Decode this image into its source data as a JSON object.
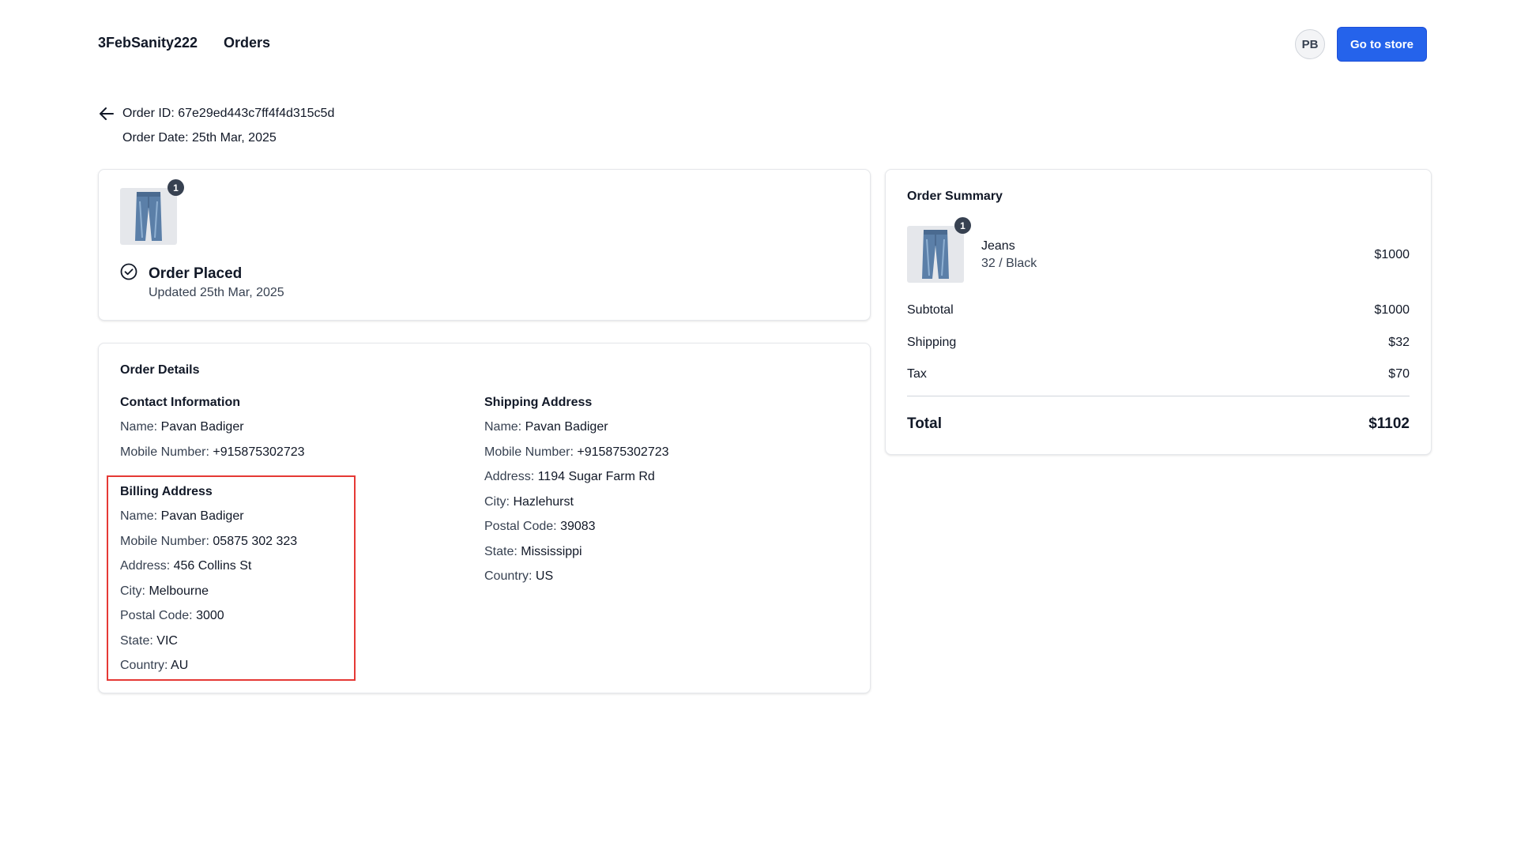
{
  "header": {
    "brand": "3FebSanity222",
    "nav_orders": "Orders",
    "avatar_initials": "PB",
    "store_button": "Go to store",
    "accent_color": "#2563eb"
  },
  "order": {
    "id_line": "Order ID: 67e29ed443c7ff4f4d315c5d",
    "date_line": "Order Date: 25th Mar, 2025"
  },
  "status": {
    "item_quantity": "1",
    "title": "Order Placed",
    "updated": "Updated 25th Mar, 2025"
  },
  "details": {
    "title": "Order Details",
    "contact": {
      "title": "Contact Information",
      "name_label": "Name:",
      "name": "Pavan Badiger",
      "mobile_label": "Mobile Number:",
      "mobile": "+915875302723"
    },
    "billing": {
      "title": "Billing Address",
      "name_label": "Name:",
      "name": "Pavan Badiger",
      "mobile_label": "Mobile Number:",
      "mobile": "05875 302 323",
      "address_label": "Address:",
      "address": "456 Collins St",
      "city_label": "City:",
      "city": "Melbourne",
      "postal_label": "Postal Code:",
      "postal": "3000",
      "state_label": "State:",
      "state": "VIC",
      "country_label": "Country:",
      "country": "AU"
    },
    "shipping": {
      "title": "Shipping Address",
      "name_label": "Name:",
      "name": "Pavan Badiger",
      "mobile_label": "Mobile Number:",
      "mobile": "+915875302723",
      "address_label": "Address:",
      "address": "1194 Sugar Farm Rd",
      "city_label": "City:",
      "city": "Hazlehurst",
      "postal_label": "Postal Code:",
      "postal": "39083",
      "state_label": "State:",
      "state": "Mississippi",
      "country_label": "Country:",
      "country": "US"
    }
  },
  "summary": {
    "title": "Order Summary",
    "item": {
      "quantity": "1",
      "name": "Jeans",
      "variant": "32 / Black",
      "price": "$1000",
      "icon": "jeans-image"
    },
    "subtotal_label": "Subtotal",
    "subtotal": "$1000",
    "shipping_label": "Shipping",
    "shipping": "$32",
    "tax_label": "Tax",
    "tax": "$70",
    "total_label": "Total",
    "total": "$1102"
  }
}
